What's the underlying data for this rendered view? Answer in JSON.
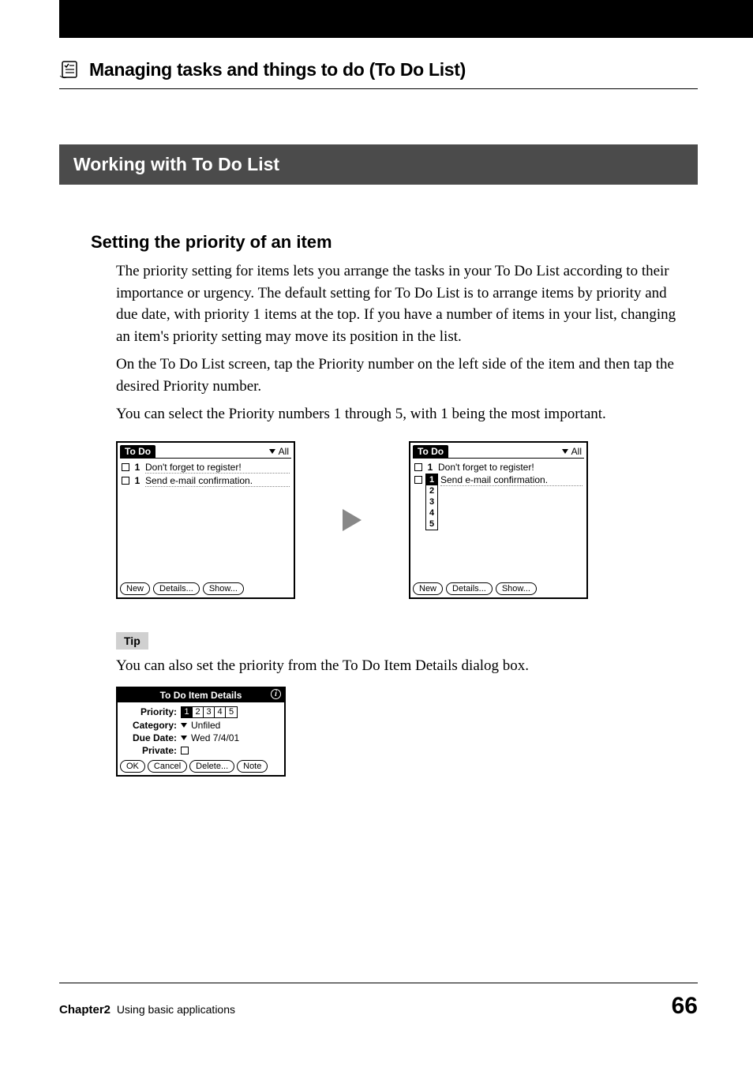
{
  "header": {
    "page_title": "Managing tasks and things to do (To Do List)"
  },
  "section": {
    "band_title": "Working with To Do List",
    "sub_heading": "Setting the priority of an item",
    "para1": "The priority setting for items lets you arrange the tasks in your To Do List according to their importance or urgency. The default setting for To Do List is to arrange items by priority and due date, with priority 1 items at the top. If you have a number of items in your list, changing an item's priority setting may move its position in the list.",
    "para2": "On the To Do List screen, tap the Priority number on the left side of the item and then tap the desired Priority number.",
    "para3": "You can select the Priority numbers 1 through 5, with 1 being the most important."
  },
  "palm_left": {
    "title": "To Do",
    "category": "All",
    "rows": [
      {
        "priority": "1",
        "text": "Don't forget to register!"
      },
      {
        "priority": "1",
        "text": "Send e-mail confirmation."
      }
    ],
    "buttons": {
      "new": "New",
      "details": "Details...",
      "show": "Show..."
    }
  },
  "palm_right": {
    "title": "To Do",
    "category": "All",
    "rows": [
      {
        "priority": "1",
        "text": "Don't forget to register!"
      },
      {
        "priority_selected": "1",
        "text": "Send e-mail confirmation."
      }
    ],
    "popup": [
      "1",
      "2",
      "3",
      "4",
      "5"
    ],
    "buttons": {
      "new": "New",
      "details": "Details...",
      "show": "Show..."
    }
  },
  "tip": {
    "label": "Tip",
    "text": "You can also set the priority from the To Do Item Details dialog box."
  },
  "details_dialog": {
    "title": "To Do Item Details",
    "priority_label": "Priority:",
    "priority_opts": [
      "1",
      "2",
      "3",
      "4",
      "5"
    ],
    "priority_selected": "1",
    "category_label": "Category:",
    "category_value": "Unfiled",
    "duedate_label": "Due Date:",
    "duedate_value": "Wed 7/4/01",
    "private_label": "Private:",
    "buttons": {
      "ok": "OK",
      "cancel": "Cancel",
      "delete": "Delete...",
      "note": "Note"
    }
  },
  "footer": {
    "chapter_label": "Chapter2",
    "chapter_desc": "Using basic applications",
    "page_number": "66"
  }
}
